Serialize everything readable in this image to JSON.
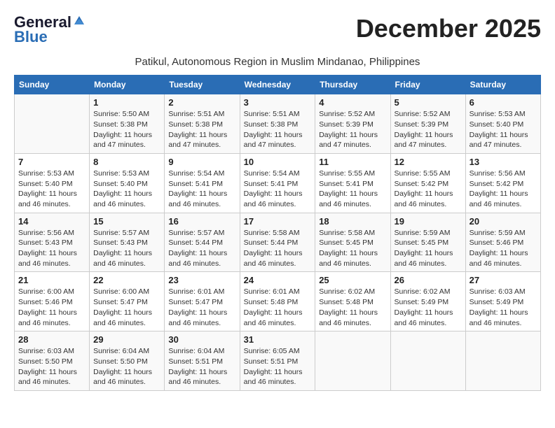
{
  "header": {
    "logo_line1": "General",
    "logo_line2": "Blue",
    "month_year": "December 2025",
    "location": "Patikul, Autonomous Region in Muslim Mindanao, Philippines"
  },
  "columns": [
    "Sunday",
    "Monday",
    "Tuesday",
    "Wednesday",
    "Thursday",
    "Friday",
    "Saturday"
  ],
  "weeks": [
    [
      {
        "day": "",
        "info": ""
      },
      {
        "day": "1",
        "info": "Sunrise: 5:50 AM\nSunset: 5:38 PM\nDaylight: 11 hours and 47 minutes."
      },
      {
        "day": "2",
        "info": "Sunrise: 5:51 AM\nSunset: 5:38 PM\nDaylight: 11 hours and 47 minutes."
      },
      {
        "day": "3",
        "info": "Sunrise: 5:51 AM\nSunset: 5:38 PM\nDaylight: 11 hours and 47 minutes."
      },
      {
        "day": "4",
        "info": "Sunrise: 5:52 AM\nSunset: 5:39 PM\nDaylight: 11 hours and 47 minutes."
      },
      {
        "day": "5",
        "info": "Sunrise: 5:52 AM\nSunset: 5:39 PM\nDaylight: 11 hours and 47 minutes."
      },
      {
        "day": "6",
        "info": "Sunrise: 5:53 AM\nSunset: 5:40 PM\nDaylight: 11 hours and 47 minutes."
      }
    ],
    [
      {
        "day": "7",
        "info": "Sunrise: 5:53 AM\nSunset: 5:40 PM\nDaylight: 11 hours and 46 minutes."
      },
      {
        "day": "8",
        "info": "Sunrise: 5:53 AM\nSunset: 5:40 PM\nDaylight: 11 hours and 46 minutes."
      },
      {
        "day": "9",
        "info": "Sunrise: 5:54 AM\nSunset: 5:41 PM\nDaylight: 11 hours and 46 minutes."
      },
      {
        "day": "10",
        "info": "Sunrise: 5:54 AM\nSunset: 5:41 PM\nDaylight: 11 hours and 46 minutes."
      },
      {
        "day": "11",
        "info": "Sunrise: 5:55 AM\nSunset: 5:41 PM\nDaylight: 11 hours and 46 minutes."
      },
      {
        "day": "12",
        "info": "Sunrise: 5:55 AM\nSunset: 5:42 PM\nDaylight: 11 hours and 46 minutes."
      },
      {
        "day": "13",
        "info": "Sunrise: 5:56 AM\nSunset: 5:42 PM\nDaylight: 11 hours and 46 minutes."
      }
    ],
    [
      {
        "day": "14",
        "info": "Sunrise: 5:56 AM\nSunset: 5:43 PM\nDaylight: 11 hours and 46 minutes."
      },
      {
        "day": "15",
        "info": "Sunrise: 5:57 AM\nSunset: 5:43 PM\nDaylight: 11 hours and 46 minutes."
      },
      {
        "day": "16",
        "info": "Sunrise: 5:57 AM\nSunset: 5:44 PM\nDaylight: 11 hours and 46 minutes."
      },
      {
        "day": "17",
        "info": "Sunrise: 5:58 AM\nSunset: 5:44 PM\nDaylight: 11 hours and 46 minutes."
      },
      {
        "day": "18",
        "info": "Sunrise: 5:58 AM\nSunset: 5:45 PM\nDaylight: 11 hours and 46 minutes."
      },
      {
        "day": "19",
        "info": "Sunrise: 5:59 AM\nSunset: 5:45 PM\nDaylight: 11 hours and 46 minutes."
      },
      {
        "day": "20",
        "info": "Sunrise: 5:59 AM\nSunset: 5:46 PM\nDaylight: 11 hours and 46 minutes."
      }
    ],
    [
      {
        "day": "21",
        "info": "Sunrise: 6:00 AM\nSunset: 5:46 PM\nDaylight: 11 hours and 46 minutes."
      },
      {
        "day": "22",
        "info": "Sunrise: 6:00 AM\nSunset: 5:47 PM\nDaylight: 11 hours and 46 minutes."
      },
      {
        "day": "23",
        "info": "Sunrise: 6:01 AM\nSunset: 5:47 PM\nDaylight: 11 hours and 46 minutes."
      },
      {
        "day": "24",
        "info": "Sunrise: 6:01 AM\nSunset: 5:48 PM\nDaylight: 11 hours and 46 minutes."
      },
      {
        "day": "25",
        "info": "Sunrise: 6:02 AM\nSunset: 5:48 PM\nDaylight: 11 hours and 46 minutes."
      },
      {
        "day": "26",
        "info": "Sunrise: 6:02 AM\nSunset: 5:49 PM\nDaylight: 11 hours and 46 minutes."
      },
      {
        "day": "27",
        "info": "Sunrise: 6:03 AM\nSunset: 5:49 PM\nDaylight: 11 hours and 46 minutes."
      }
    ],
    [
      {
        "day": "28",
        "info": "Sunrise: 6:03 AM\nSunset: 5:50 PM\nDaylight: 11 hours and 46 minutes."
      },
      {
        "day": "29",
        "info": "Sunrise: 6:04 AM\nSunset: 5:50 PM\nDaylight: 11 hours and 46 minutes."
      },
      {
        "day": "30",
        "info": "Sunrise: 6:04 AM\nSunset: 5:51 PM\nDaylight: 11 hours and 46 minutes."
      },
      {
        "day": "31",
        "info": "Sunrise: 6:05 AM\nSunset: 5:51 PM\nDaylight: 11 hours and 46 minutes."
      },
      {
        "day": "",
        "info": ""
      },
      {
        "day": "",
        "info": ""
      },
      {
        "day": "",
        "info": ""
      }
    ]
  ]
}
